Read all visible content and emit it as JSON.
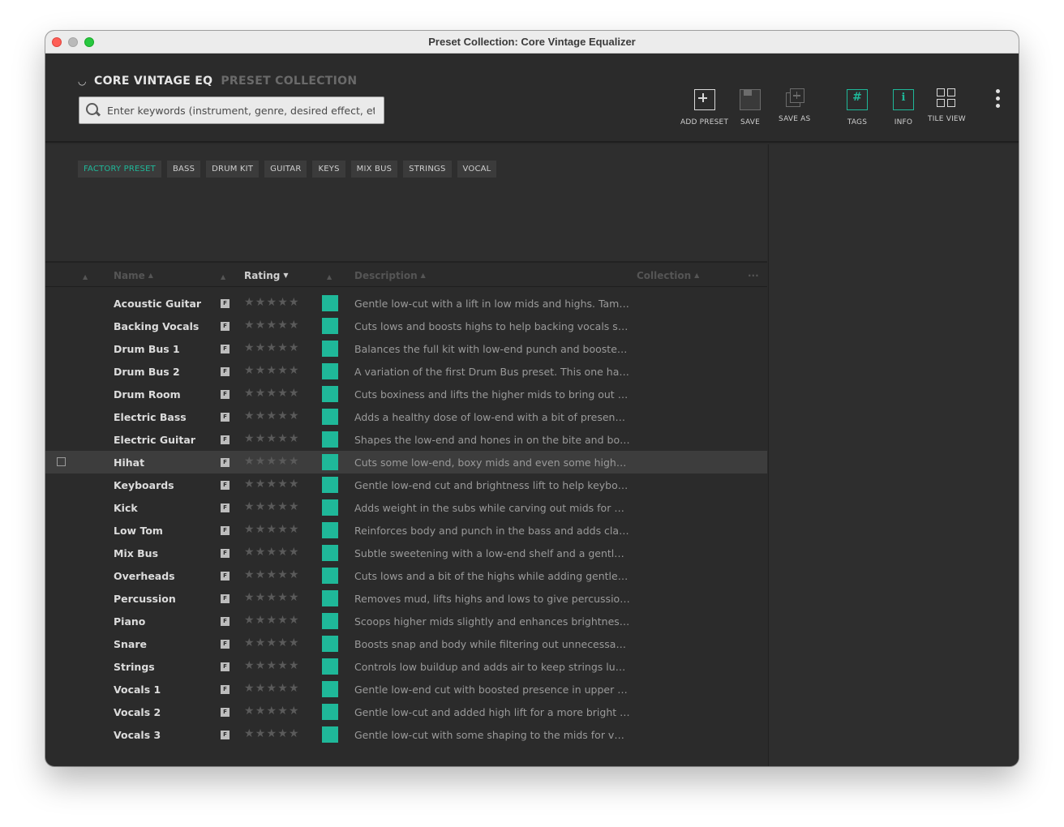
{
  "window": {
    "title": "Preset Collection: Core Vintage Equalizer"
  },
  "brand": {
    "name": "CORE VINTAGE EQ",
    "section": "PRESET COLLECTION"
  },
  "search": {
    "placeholder": "Enter keywords (instrument, genre, desired effect, etc.)"
  },
  "toolbar": {
    "add_preset": "ADD PRESET",
    "save": "SAVE",
    "save_as": "SAVE AS",
    "tags": "TAGS",
    "info": "INFO",
    "tile_view": "TILE VIEW"
  },
  "tags": [
    "FACTORY PRESET",
    "BASS",
    "DRUM KIT",
    "GUITAR",
    "KEYS",
    "MIX BUS",
    "STRINGS",
    "VOCAL"
  ],
  "active_tag": "FACTORY PRESET",
  "columns": {
    "name": "Name",
    "rating": "Rating",
    "description": "Description",
    "collection": "Collection",
    "more": "···"
  },
  "colors": {
    "accent": "#1fb899",
    "background": "#2b2b2b"
  },
  "presets": [
    {
      "name": "Acoustic Guitar",
      "badge": "F",
      "rating": 0,
      "description": "Gentle low-cut with a lift in low mids and highs. Tames..."
    },
    {
      "name": "Backing Vocals",
      "badge": "F",
      "rating": 0,
      "description": "Cuts lows and boosts highs to help backing vocals sit ..."
    },
    {
      "name": "Drum Bus 1",
      "badge": "F",
      "rating": 0,
      "description": "Balances the full kit with low-end punch and boosted ..."
    },
    {
      "name": "Drum Bus 2",
      "badge": "F",
      "rating": 0,
      "description": "A variation of the first Drum Bus preset. This one has ..."
    },
    {
      "name": "Drum Room",
      "badge": "F",
      "rating": 0,
      "description": "Cuts boxiness and lifts the higher mids to bring out th..."
    },
    {
      "name": "Electric Bass",
      "badge": "F",
      "rating": 0,
      "description": "Adds a healthy dose of low-end with a bit of presence ..."
    },
    {
      "name": "Electric Guitar",
      "badge": "F",
      "rating": 0,
      "description": "Shapes the low-end and hones in on the bite and bod..."
    },
    {
      "name": "Hihat",
      "badge": "F",
      "rating": 0,
      "description": "Cuts some low-end, boxy mids and even some highs fo..."
    },
    {
      "name": "Keyboards",
      "badge": "F",
      "rating": 0,
      "description": "Gentle low-end cut and brightness lift to help keyboar..."
    },
    {
      "name": "Kick",
      "badge": "F",
      "rating": 0,
      "description": "Adds weight in the subs while carving out mids for mo..."
    },
    {
      "name": "Low Tom",
      "badge": "F",
      "rating": 0,
      "description": "Reinforces body and punch in the bass and adds clari..."
    },
    {
      "name": "Mix Bus",
      "badge": "F",
      "rating": 0,
      "description": "Subtle sweetening with a low-end shelf and a gentle h..."
    },
    {
      "name": "Overheads",
      "badge": "F",
      "rating": 0,
      "description": "Cuts lows and a bit of the highs while adding gentle b..."
    },
    {
      "name": "Percussion",
      "badge": "F",
      "rating": 0,
      "description": "Removes mud, lifts highs and lows to give percussion t..."
    },
    {
      "name": "Piano",
      "badge": "F",
      "rating": 0,
      "description": "Scoops higher mids slightly and enhances brightness ..."
    },
    {
      "name": "Snare",
      "badge": "F",
      "rating": 0,
      "description": "Boosts snap and body while filtering out unnecessary ..."
    },
    {
      "name": "Strings",
      "badge": "F",
      "rating": 0,
      "description": "Controls low buildup and adds air to keep strings lush ..."
    },
    {
      "name": "Vocals 1",
      "badge": "F",
      "rating": 0,
      "description": "Gentle low-end cut with boosted presence in upper mi..."
    },
    {
      "name": "Vocals 2",
      "badge": "F",
      "rating": 0,
      "description": "Gentle low-cut and added high lift for a more bright a..."
    },
    {
      "name": "Vocals 3",
      "badge": "F",
      "rating": 0,
      "description": "Gentle low-cut with some shaping to the mids for voca..."
    }
  ],
  "highlighted_row": "Hihat"
}
